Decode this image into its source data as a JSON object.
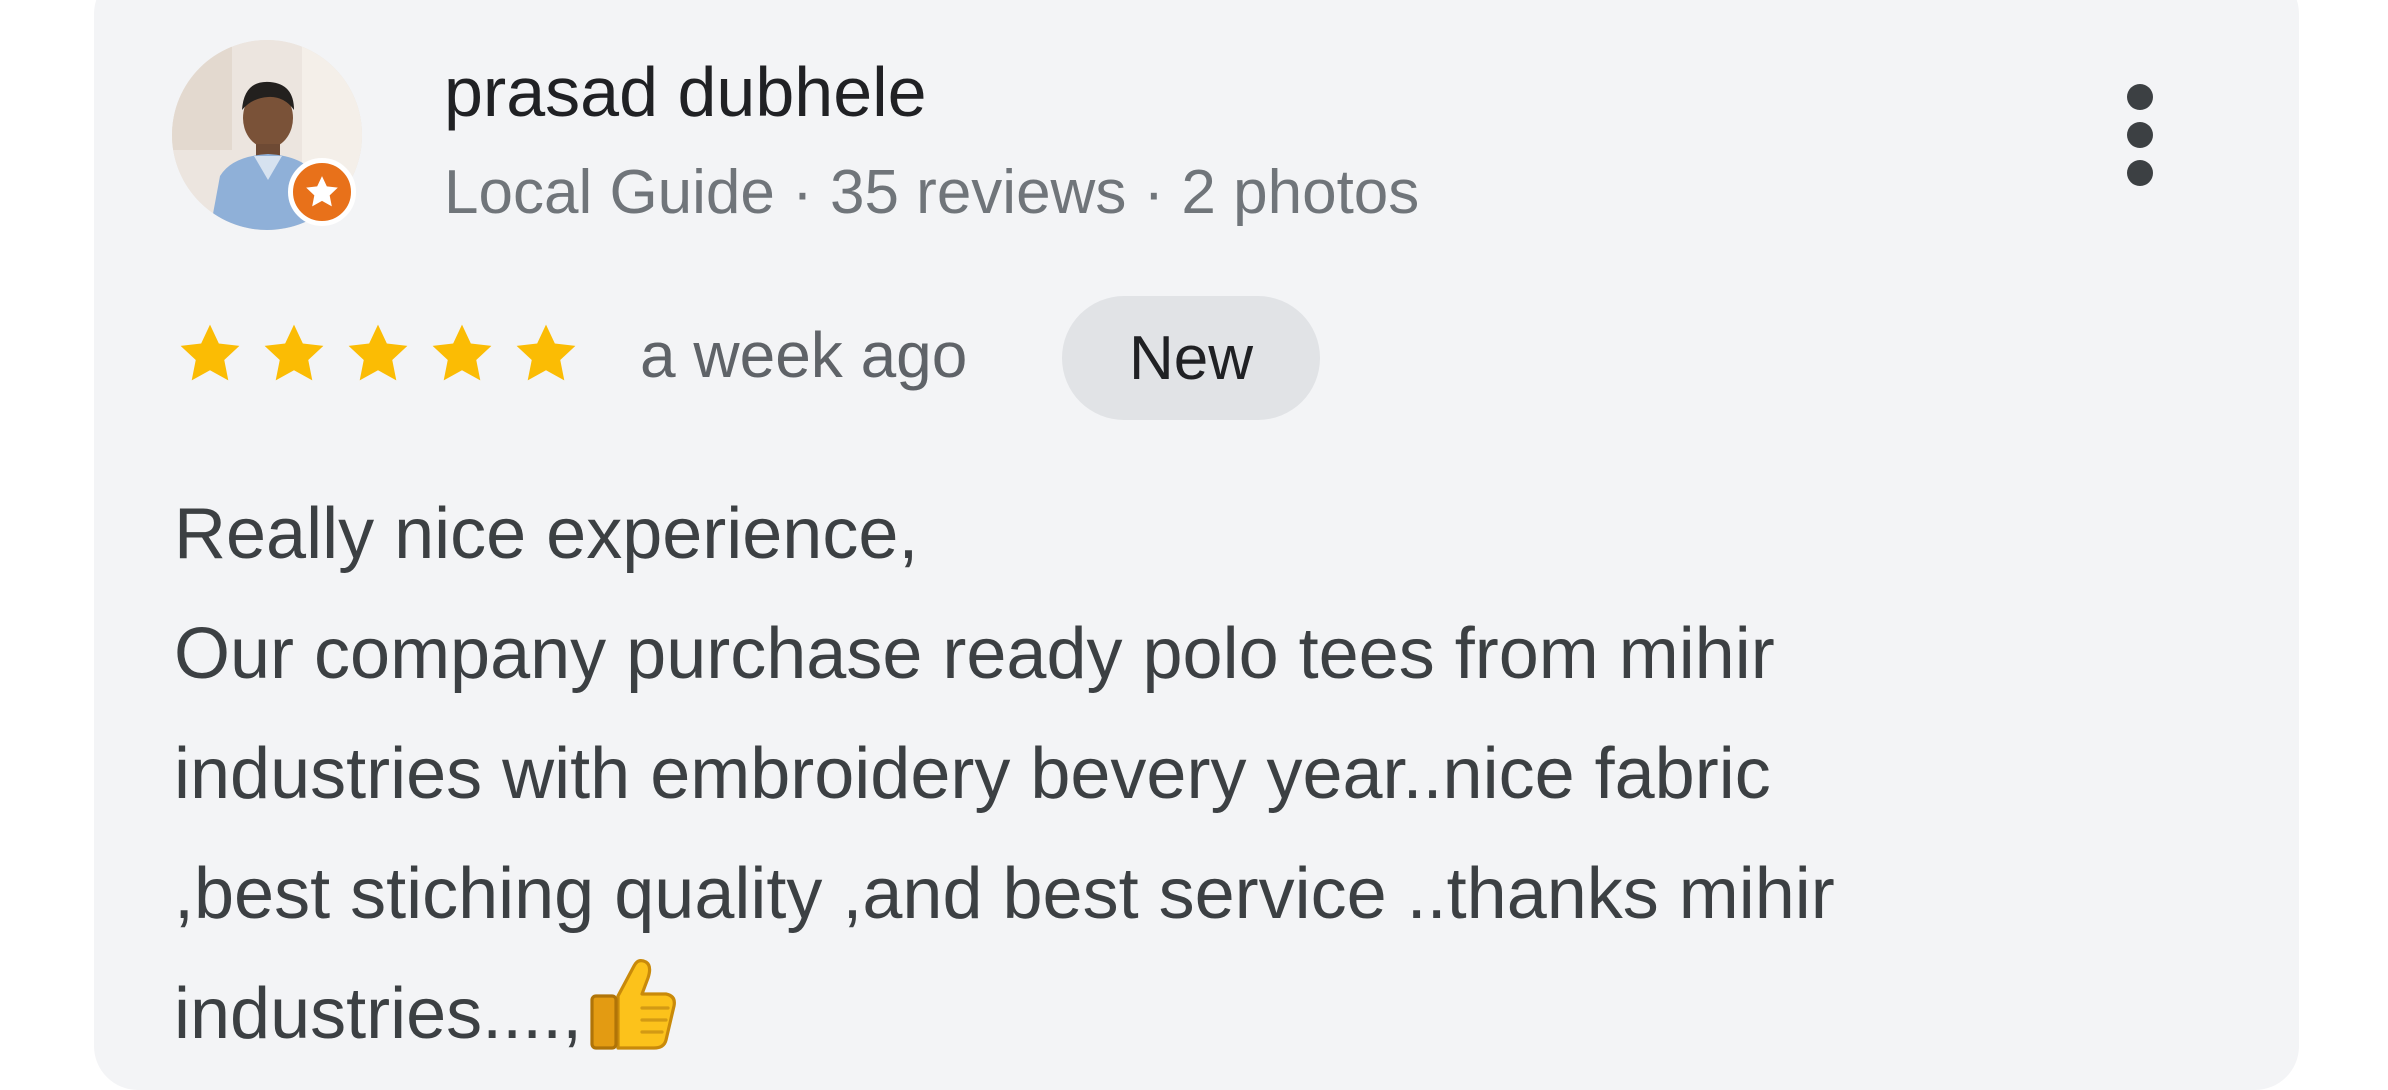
{
  "review": {
    "reviewer": {
      "name": "prasad dubhele",
      "meta": "Local Guide · 35 reviews · 2 photos"
    },
    "rating": 5,
    "rating_max": 5,
    "time_ago": "a week ago",
    "badge": "New",
    "text_lines": [
      "Really nice experience,",
      "Our company purchase ready polo tees from mihir",
      "industries with embroidery bevery year..nice fabric",
      ",best stiching quality ,and best service ..thanks mihir",
      "industries....,"
    ]
  },
  "icons": {
    "avatar": "profile-photo",
    "guide_badge": "star-badge-icon",
    "more": "more-vertical-icon",
    "rating_star": "star-icon",
    "emoji": "thumbs-up-icon"
  },
  "colors": {
    "card_background": "#f3f4f6",
    "star": "#fbbc04",
    "local_guide_badge": "#e8711a",
    "new_badge_background": "#e1e3e6",
    "name_text": "#202124",
    "meta_text": "#70757a",
    "body_text": "#3c4043"
  }
}
